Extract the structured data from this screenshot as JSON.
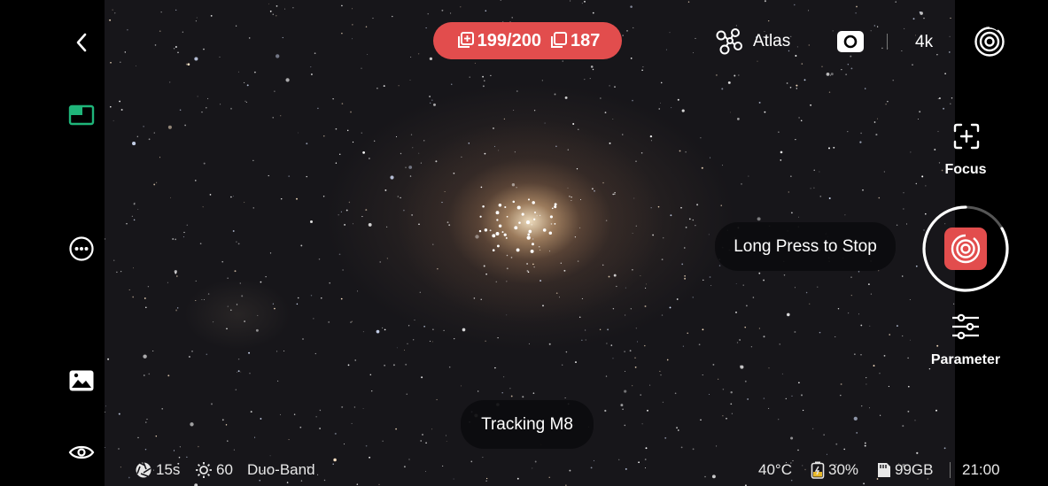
{
  "header": {
    "stack_count": "199/200",
    "saved_count": "187",
    "atlas_label": "Atlas",
    "resolution_label": "4k"
  },
  "toasts": {
    "stop_hint": "Long Press to Stop",
    "tracking": "Tracking M8"
  },
  "right_panel": {
    "focus_label": "Focus",
    "parameter_label": "Parameter"
  },
  "status_bar": {
    "exposure": "15s",
    "gain": "60",
    "filter": "Duo-Band",
    "temperature": "40°C",
    "battery": "30%",
    "storage": "99GB",
    "time": "21:00"
  },
  "colors": {
    "accent_red": "#e24d4d",
    "accent_green": "#1fb57a"
  },
  "icons": [
    "back-icon",
    "stack-icon",
    "saved-frames-icon",
    "atlas-icon",
    "camera-toggle-icon",
    "target-icon",
    "layout-icon",
    "more-icon",
    "gallery-icon",
    "eye-icon",
    "focus-icon",
    "shutter-icon",
    "parameter-icon",
    "exposure-icon",
    "gain-icon",
    "battery-icon",
    "sd-card-icon"
  ]
}
